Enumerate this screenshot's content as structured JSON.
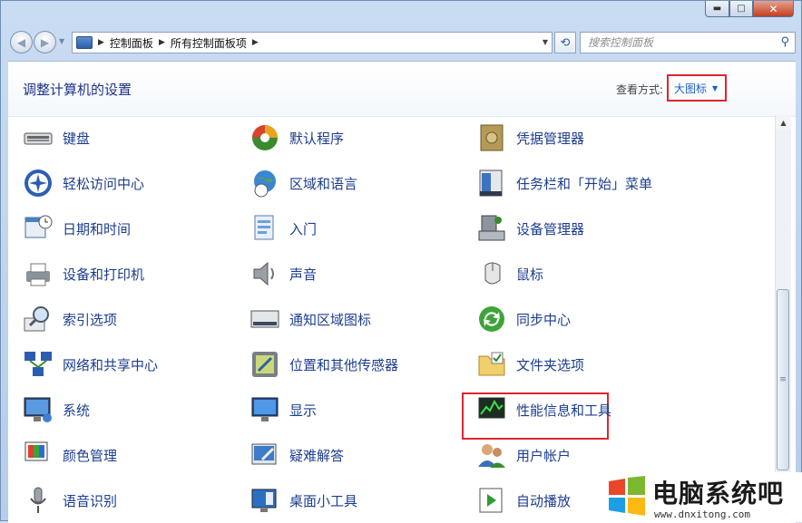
{
  "window": {
    "controls": {
      "minimize": "▬",
      "maximize": "□",
      "close": "✕"
    }
  },
  "nav": {
    "back_icon": "back-arrow-icon",
    "forward_icon": "forward-arrow-icon",
    "breadcrumb": [
      "控制面板",
      "所有控制面板项"
    ],
    "search_placeholder": "搜索控制面板"
  },
  "header": {
    "title": "调整计算机的设置",
    "view_label": "查看方式:",
    "view_value": "大图标"
  },
  "items": [
    [
      {
        "label": "键盘",
        "icon": "keyboard-icon"
      },
      {
        "label": "轻松访问中心",
        "icon": "ease-of-access-icon"
      },
      {
        "label": "日期和时间",
        "icon": "calendar-clock-icon"
      },
      {
        "label": "设备和打印机",
        "icon": "printer-icon"
      },
      {
        "label": "索引选项",
        "icon": "index-magnifier-icon"
      },
      {
        "label": "网络和共享中心",
        "icon": "network-icon"
      },
      {
        "label": "系统",
        "icon": "system-monitor-icon"
      },
      {
        "label": "颜色管理",
        "icon": "color-management-icon"
      },
      {
        "label": "语音识别",
        "icon": "microphone-icon"
      }
    ],
    [
      {
        "label": "默认程序",
        "icon": "default-programs-icon"
      },
      {
        "label": "区域和语言",
        "icon": "globe-clock-icon"
      },
      {
        "label": "入门",
        "icon": "getting-started-icon"
      },
      {
        "label": "声音",
        "icon": "speaker-icon"
      },
      {
        "label": "通知区域图标",
        "icon": "notification-area-icon"
      },
      {
        "label": "位置和其他传感器",
        "icon": "sensor-icon"
      },
      {
        "label": "显示",
        "icon": "display-icon"
      },
      {
        "label": "疑难解答",
        "icon": "troubleshooting-icon"
      },
      {
        "label": "桌面小工具",
        "icon": "gadgets-icon"
      }
    ],
    [
      {
        "label": "凭据管理器",
        "icon": "credential-vault-icon"
      },
      {
        "label": "任务栏和「开始」菜单",
        "icon": "taskbar-icon"
      },
      {
        "label": "设备管理器",
        "icon": "device-manager-icon"
      },
      {
        "label": "鼠标",
        "icon": "mouse-icon"
      },
      {
        "label": "同步中心",
        "icon": "sync-center-icon"
      },
      {
        "label": "文件夹选项",
        "icon": "folder-options-icon"
      },
      {
        "label": "性能信息和工具",
        "icon": "performance-icon"
      },
      {
        "label": "用户帐户",
        "icon": "user-accounts-icon"
      },
      {
        "label": "自动播放",
        "icon": "autoplay-icon"
      }
    ]
  ],
  "watermark": {
    "title": "电脑系统吧",
    "url": "www.dnxitong.com"
  },
  "colors": {
    "link": "#1c3d8f",
    "highlight": "#d9272e"
  }
}
